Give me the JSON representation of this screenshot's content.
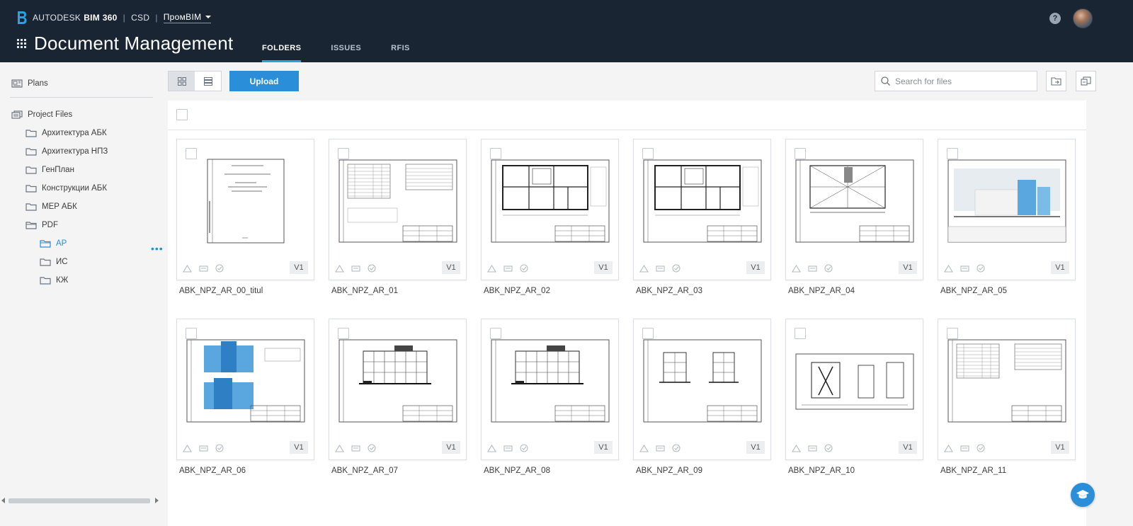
{
  "header": {
    "brand_vendor": "AUTODESK",
    "brand_product": "BIM 360",
    "account": "CSD",
    "project": "ПромBIM",
    "app_title": "Document Management",
    "tabs": [
      {
        "label": "FOLDERS",
        "active": true
      },
      {
        "label": "ISSUES",
        "active": false
      },
      {
        "label": "RFIS",
        "active": false
      }
    ],
    "help_glyph": "?"
  },
  "sidebar": {
    "plans": "Plans",
    "project_files": "Project Files",
    "folders": [
      {
        "label": "Архитектура АБК",
        "level": 1
      },
      {
        "label": "Архитектура НПЗ",
        "level": 1
      },
      {
        "label": "ГенПлан",
        "level": 1
      },
      {
        "label": "Конструкции АБК",
        "level": 1
      },
      {
        "label": "MEP АБК",
        "level": 1
      },
      {
        "label": "PDF",
        "level": 1,
        "expanded": true
      },
      {
        "label": "АР",
        "level": 2,
        "active": true
      },
      {
        "label": "ИС",
        "level": 2
      },
      {
        "label": "КЖ",
        "level": 2
      }
    ],
    "more_glyph": "•••"
  },
  "toolbar": {
    "upload_label": "Upload",
    "search_placeholder": "Search for files"
  },
  "files": [
    {
      "name": "ABK_NPZ_AR_00_titul",
      "version": "V1",
      "kind": "title"
    },
    {
      "name": "ABK_NPZ_AR_01",
      "version": "V1",
      "kind": "table"
    },
    {
      "name": "ABK_NPZ_AR_02",
      "version": "V1",
      "kind": "plan"
    },
    {
      "name": "ABK_NPZ_AR_03",
      "version": "V1",
      "kind": "plan"
    },
    {
      "name": "ABK_NPZ_AR_04",
      "version": "V1",
      "kind": "roof"
    },
    {
      "name": "ABK_NPZ_AR_05",
      "version": "V1",
      "kind": "facade-color"
    },
    {
      "name": "ABK_NPZ_AR_06",
      "version": "V1",
      "kind": "facade-color2"
    },
    {
      "name": "ABK_NPZ_AR_07",
      "version": "V1",
      "kind": "facade"
    },
    {
      "name": "ABK_NPZ_AR_08",
      "version": "V1",
      "kind": "facade"
    },
    {
      "name": "ABK_NPZ_AR_09",
      "version": "V1",
      "kind": "section"
    },
    {
      "name": "ABK_NPZ_AR_10",
      "version": "V1",
      "kind": "sections"
    },
    {
      "name": "ABK_NPZ_AR_11",
      "version": "V1",
      "kind": "table2"
    }
  ],
  "colors": {
    "header_bg": "#1a2533",
    "accent": "#2a8fd8",
    "tab_underline": "#2aa2e0"
  }
}
